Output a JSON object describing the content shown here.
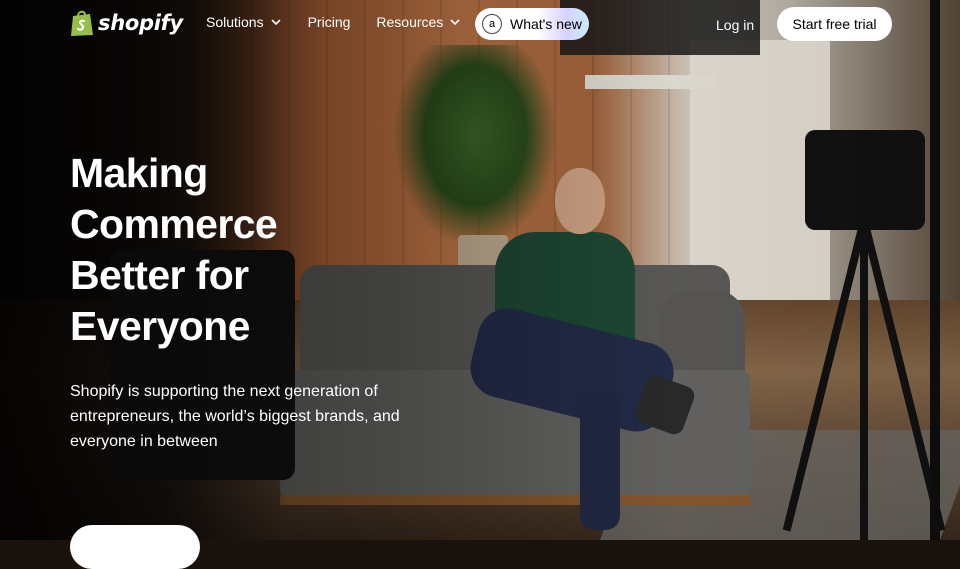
{
  "brand": {
    "name": "shopify",
    "logo_icon": "shopify-bag-icon",
    "logo_color": "#95bf47"
  },
  "nav": {
    "items": [
      {
        "label": "Solutions",
        "has_dropdown": true
      },
      {
        "label": "Pricing",
        "has_dropdown": false
      },
      {
        "label": "Resources",
        "has_dropdown": true
      }
    ],
    "whats_new": {
      "label": "What's new",
      "badge": "a"
    },
    "login_label": "Log in",
    "trial_label": "Start free trial"
  },
  "hero": {
    "title_lines": [
      "Making",
      "Commerce",
      "Better for",
      "Everyone"
    ],
    "subtitle": "Shopify is supporting the next generation of entrepreneurs, the world’s biggest brands, and everyone in between",
    "cta_label": ""
  },
  "colors": {
    "accent": "#95bf47",
    "button_bg": "#ffffff",
    "text": "#ffffff"
  }
}
